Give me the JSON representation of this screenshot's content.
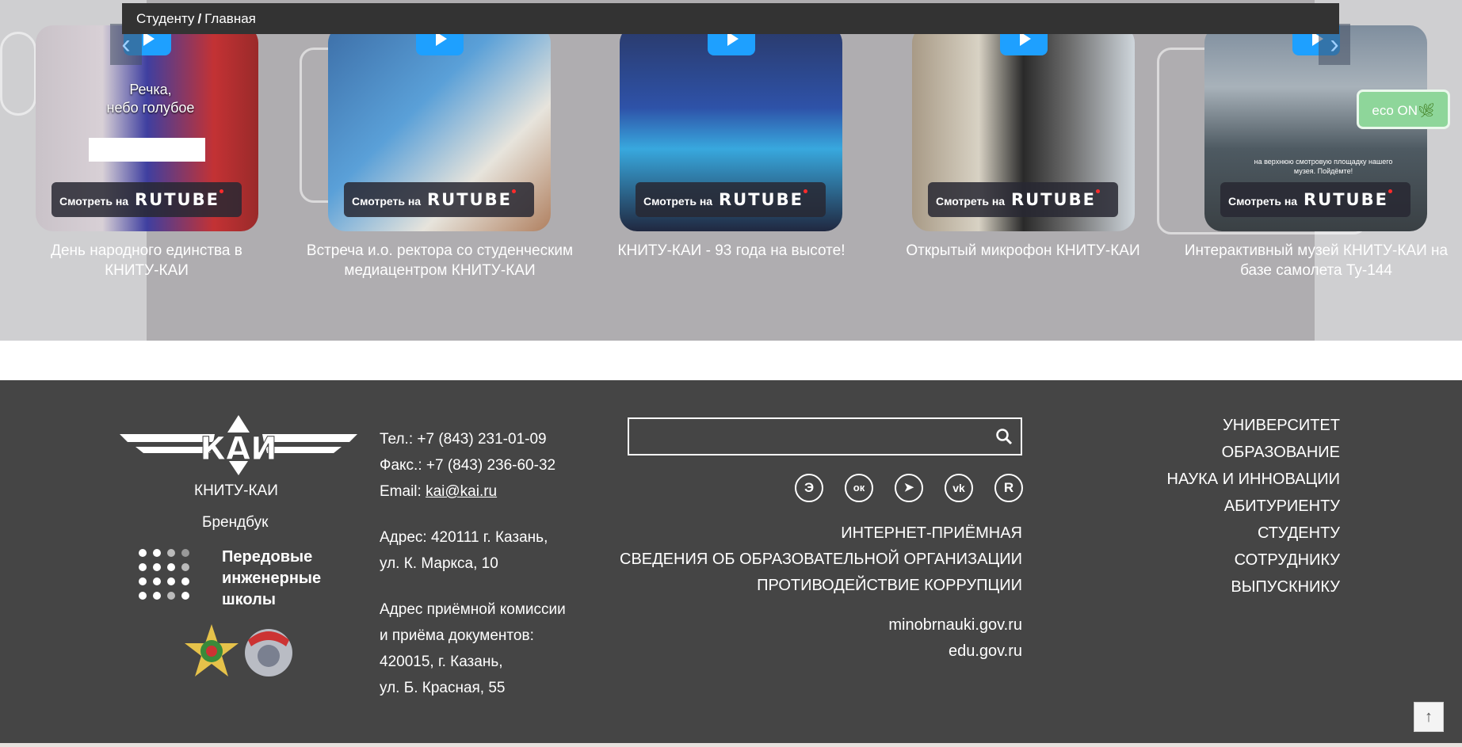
{
  "breadcrumb": {
    "parent": "Студенту",
    "separator": "/",
    "current": "Главная"
  },
  "eco_badge": "eco ON",
  "videos": [
    {
      "overlay": "Речка,\nнебо голубое",
      "watch_label": "Смотреть на",
      "brand": "RUTUBE",
      "caption": "День народного единства в КНИТУ-КАИ"
    },
    {
      "watch_label": "Смотреть на",
      "brand": "RUTUBE",
      "caption": "Встреча и.о. ректора со студенческим медиацентром КНИТУ-КАИ"
    },
    {
      "watch_label": "Смотреть на",
      "brand": "RUTUBE",
      "caption": "КНИТУ-КАИ - 93 года на высоте!"
    },
    {
      "watch_label": "Смотреть на",
      "brand": "RUTUBE",
      "caption": "Открытый микрофон КНИТУ-КАИ"
    },
    {
      "overlay": "на верхнюю смотровую площадку нашего музея. Пойдёмте!",
      "watch_label": "Смотреть на",
      "brand": "RUTUBE",
      "caption": "Интерактивный музей КНИТУ-КАИ на базе самолета Ту-144"
    }
  ],
  "footer": {
    "logo_text": "КАИ",
    "org_name": "КНИТУ-КАИ",
    "brandbook": "Брендбук",
    "pis_label": "Передовые инженерные школы",
    "phone": "Тел.: +7 (843) 231-01-09",
    "fax": "Факс.: +7 (843) 236-60-32",
    "email_label": "Email:",
    "email": "kai@kai.ru",
    "address_line1": "Адрес: 420111 г. Казань,",
    "address_line2": "ул. К. Маркса, 10",
    "admission_line1": "Адрес приёмной комиссии",
    "admission_line2": "и приёма документов:",
    "admission_line3": "420015, г. Казань,",
    "admission_line4": "ул. Б. Красная, 55",
    "search_value": "",
    "social": [
      {
        "icon": "e-icon",
        "glyph": "Э"
      },
      {
        "icon": "odnoklassniki-icon",
        "glyph": "ок"
      },
      {
        "icon": "telegram-icon",
        "glyph": "➤"
      },
      {
        "icon": "vk-icon",
        "glyph": "vk"
      },
      {
        "icon": "rutube-icon",
        "glyph": "R"
      }
    ],
    "links": [
      "ИНТЕРНЕТ-ПРИЁМНАЯ",
      "СВЕДЕНИЯ ОБ ОБРАЗОВАТЕЛЬНОЙ ОРГАНИЗАЦИИ",
      "ПРОТИВОДЕЙСТВИЕ КОРРУПЦИИ"
    ],
    "ext_links": [
      "minobrnauki.gov.ru",
      "edu.gov.ru"
    ],
    "nav": [
      "УНИВЕРСИТЕТ",
      "ОБРАЗОВАНИЕ",
      "НАУКА И ИННОВАЦИИ",
      "АБИТУРИЕНТУ",
      "СТУДЕНТУ",
      "СОТРУДНИКУ",
      "ВЫПУСКНИКУ"
    ],
    "to_top": "↑"
  },
  "colors": {
    "footer_bg": "#454545",
    "breadcrumb_bg": "#333333",
    "play": "#1ea0ff",
    "eco": "#8ed69a"
  }
}
